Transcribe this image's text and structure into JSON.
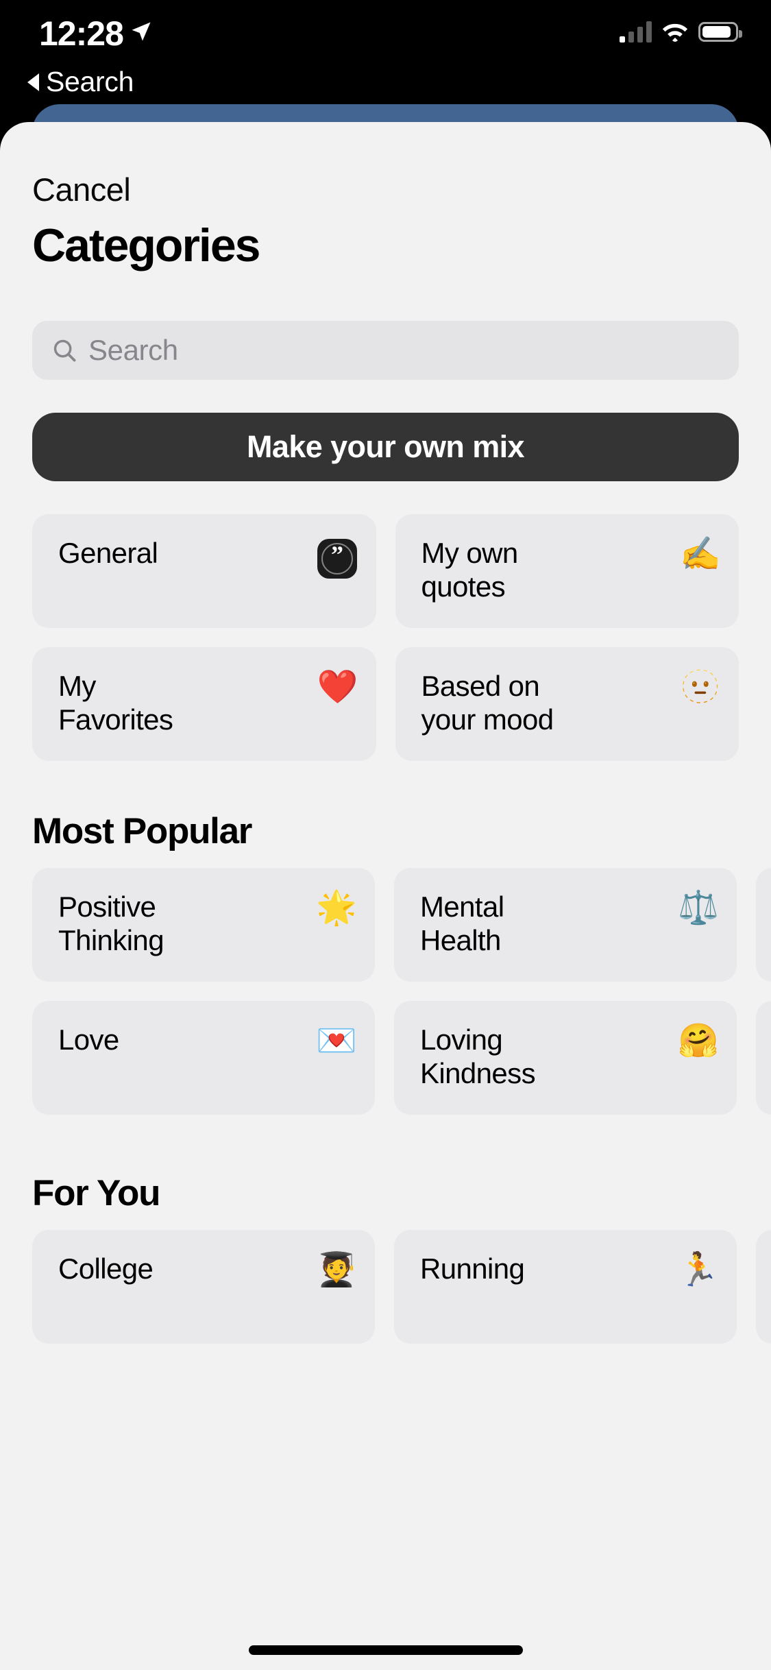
{
  "status_bar": {
    "time": "12:28",
    "location_icon": "location-arrow-icon",
    "cellular_icon": "cellular-bars-icon",
    "wifi_icon": "wifi-icon",
    "battery_icon": "battery-icon"
  },
  "back_nav": {
    "label": "Search",
    "icon": "back-triangle-icon"
  },
  "sheet": {
    "cancel_label": "Cancel",
    "title": "Categories"
  },
  "search": {
    "placeholder": "Search",
    "value": "",
    "icon": "search-icon"
  },
  "mix_button": {
    "label": "Make your own mix"
  },
  "top_cards": [
    {
      "label": "General",
      "icon": "quote-badge-icon",
      "emoji": ""
    },
    {
      "label": "My own\nquotes",
      "icon": "writing-hand-emoji",
      "emoji": "✍️"
    },
    {
      "label": "My\nFavorites",
      "icon": "red-heart-emoji",
      "emoji": "❤️"
    },
    {
      "label": "Based on\nyour mood",
      "icon": "dotted-line-face-emoji",
      "emoji": "🫥"
    }
  ],
  "sections": [
    {
      "heading": "Most Popular",
      "rows": [
        [
          {
            "label": "Positive\nThinking",
            "icon": "glowing-star-emoji",
            "emoji": "🌟"
          },
          {
            "label": "Mental\nHealth",
            "icon": "balance-scale-emoji",
            "emoji": "⚖️"
          },
          {
            "label": "",
            "icon": "partial-card",
            "emoji": ""
          }
        ],
        [
          {
            "label": "Love",
            "icon": "love-letter-emoji",
            "emoji": "💌"
          },
          {
            "label": "Loving\nKindness",
            "icon": "hugging-face-emoji",
            "emoji": "🤗"
          },
          {
            "label": "",
            "icon": "partial-card",
            "emoji": ""
          }
        ]
      ]
    },
    {
      "heading": "For You",
      "rows": [
        [
          {
            "label": "College",
            "icon": "graduate-emoji",
            "emoji": "🧑‍🎓"
          },
          {
            "label": "Running",
            "icon": "running-person-emoji",
            "emoji": "🏃"
          },
          {
            "label": "",
            "icon": "partial-card",
            "emoji": ""
          }
        ]
      ]
    }
  ],
  "colors": {
    "sheet_bg": "#f2f2f3",
    "card_bg": "#e9e9eb",
    "search_bg": "#e4e4e6",
    "mix_button_bg": "#343434",
    "behind_card": "#426691",
    "text_primary": "#000000",
    "placeholder": "#86868b"
  }
}
